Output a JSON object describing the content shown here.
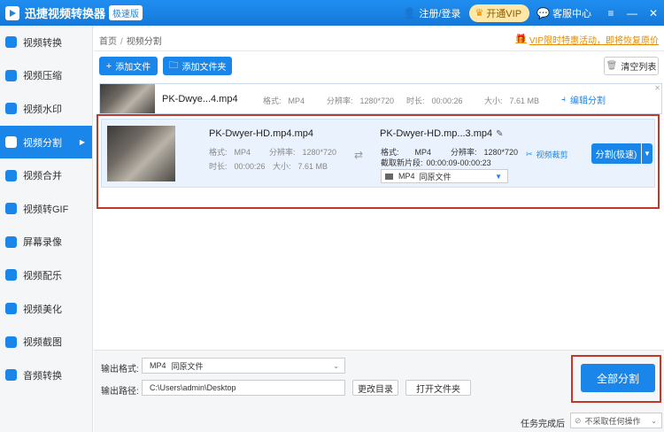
{
  "titlebar": {
    "app_title": "迅捷视频转换器",
    "edition_badge": "极速版",
    "login": "注册/登录",
    "vip": "开通VIP",
    "service": "客服中心",
    "menu_icon": "menu-icon",
    "min_icon": "minimize-icon",
    "close_icon": "close-icon"
  },
  "sidebar": {
    "items": [
      {
        "label": "视频转换",
        "icon": "video-convert-icon"
      },
      {
        "label": "视频压缩",
        "icon": "video-compress-icon"
      },
      {
        "label": "视频水印",
        "icon": "watermark-icon"
      },
      {
        "label": "视频分割",
        "icon": "split-icon",
        "active": true
      },
      {
        "label": "视频合并",
        "icon": "merge-icon"
      },
      {
        "label": "视频转GIF",
        "icon": "gif-icon"
      },
      {
        "label": "屏幕录像",
        "icon": "screen-record-icon"
      },
      {
        "label": "视频配乐",
        "icon": "music-icon"
      },
      {
        "label": "视频美化",
        "icon": "beautify-icon"
      },
      {
        "label": "视频截图",
        "icon": "screenshot-icon"
      },
      {
        "label": "音频转换",
        "icon": "audio-convert-icon"
      }
    ]
  },
  "breadcrumb": {
    "home": "首页",
    "sep": "/",
    "current": "视频分割"
  },
  "promo": "VIP限时特惠活动，即将恢复原价",
  "toolbar": {
    "add_file": "添加文件",
    "add_folder": "添加文件夹",
    "clear_list": "清空列表"
  },
  "row1": {
    "file_name": "PK-Dwye...4.mp4",
    "format_label": "格式:",
    "format": "MP4",
    "resolution_label": "分辨率:",
    "resolution": "1280*720",
    "duration_label": "时长:",
    "duration": "00:00:26",
    "size_label": "大小:",
    "size": "7.61 MB",
    "edit_split": "编辑分割"
  },
  "row2": {
    "file_name": "PK-Dwyer-HD.mp4.mp4",
    "format_label": "格式:",
    "format": "MP4",
    "resolution_label": "分辨率:",
    "resolution": "1280*720",
    "duration_label": "时长:",
    "duration": "00:00:26",
    "size_label": "大小:",
    "size": "7.61 MB",
    "output_name": "PK-Dwyer-HD.mp...3.mp4",
    "out_format_label": "格式:",
    "out_format": "MP4",
    "out_resolution_label": "分辨率:",
    "out_resolution": "1280*720",
    "clip_label": "截取新片段:",
    "clip_range": "00:00:09-00:00:23",
    "select_format": "MP4",
    "select_preset": "同原文件",
    "video_crop": "视频裁剪",
    "split_fast": "分割(极速)"
  },
  "bottom": {
    "output_format_label": "输出格式:",
    "output_format": "MP4",
    "output_preset": "同原文件",
    "output_path_label": "输出路径:",
    "output_path": "C:\\Users\\admin\\Desktop",
    "change_dir": "更改目录",
    "open_folder": "打开文件夹",
    "split_all": "全部分割",
    "task_done_label": "任务完成后",
    "task_done_option": "不采取任何操作"
  },
  "colors": {
    "accent": "#1a86ea",
    "highlight": "#c0392b",
    "vip": "#ffe7a8"
  }
}
